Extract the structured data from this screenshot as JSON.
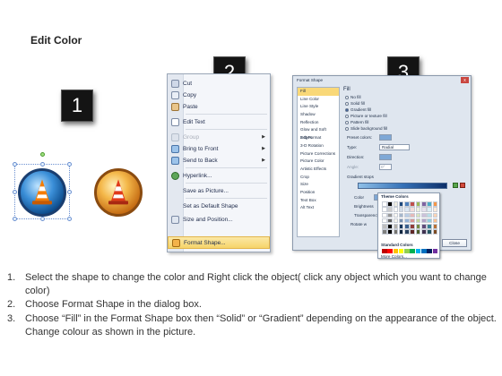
{
  "title": "Edit Color",
  "badges": [
    "1",
    "2",
    "3"
  ],
  "context_menu": {
    "items": [
      {
        "label": "Cut",
        "icon": "scissors-icon"
      },
      {
        "label": "Copy",
        "icon": "copy-icon"
      },
      {
        "label": "Paste",
        "icon": "paste-icon"
      },
      {
        "label": "Edit Text",
        "icon": "edit-text-icon"
      },
      {
        "label": "Group",
        "icon": "group-icon"
      },
      {
        "label": "Bring to Front",
        "icon": "bring-front-icon"
      },
      {
        "label": "Send to Back",
        "icon": "send-back-icon"
      },
      {
        "label": "Hyperlink...",
        "icon": "hyperlink-icon"
      },
      {
        "label": "Save as Picture...",
        "icon": ""
      },
      {
        "label": "Set as Default Shape",
        "icon": ""
      },
      {
        "label": "Size and Position...",
        "icon": "size-position-icon"
      },
      {
        "label": "Format Shape...",
        "icon": "format-shape-icon"
      }
    ]
  },
  "format_dialog": {
    "title": "Format Shape",
    "close": "x",
    "categories": [
      "Fill",
      "Line Color",
      "Line Style",
      "Shadow",
      "Reflection",
      "Glow and Soft Edges",
      "3-D Format",
      "3-D Rotation",
      "Picture Corrections",
      "Picture Color",
      "Artistic Effects",
      "Crop",
      "Size",
      "Position",
      "Text Box",
      "Alt Text"
    ],
    "selected_category": "Fill",
    "panel_heading": "Fill",
    "fill_options": [
      "No fill",
      "Solid fill",
      "Gradient fill",
      "Picture or texture fill",
      "Pattern fill",
      "Slide background fill"
    ],
    "selected_fill": "Gradient fill",
    "preset_colors_label": "Preset colors:",
    "type_label": "Type:",
    "type_value": "Radial",
    "direction_label": "Direction:",
    "angle_label": "Angle:",
    "angle_value": "0°",
    "gradient_stops_label": "Gradient stops",
    "color_label": "Color",
    "position_label": "Position:",
    "position_value": "0%",
    "brightness_label": "Brightness",
    "transparency_label": "Transparency",
    "rotate_label": "Rotate w",
    "theme_colors_label": "Theme Colors",
    "standard_colors_label": "Standard Colors",
    "more_colors_label": "More Colors...",
    "close_button": "Close",
    "theme_swatches": [
      "#ffffff",
      "#000000",
      "#eeece1",
      "#1f497d",
      "#4f81bd",
      "#c0504d",
      "#9bbb59",
      "#8064a2",
      "#4bacc6",
      "#f79646"
    ],
    "standard_swatches": [
      "#c00000",
      "#ff0000",
      "#ffc000",
      "#ffff00",
      "#92d050",
      "#00b050",
      "#00b0f0",
      "#0070c0",
      "#002060",
      "#7030a0"
    ]
  },
  "instructions": [
    {
      "num": "1.",
      "text": "Select the shape to change the color and Right click the object( click any object which you want to change color)"
    },
    {
      "num": "2.",
      "text": "Choose Format Shape in the dialog box."
    },
    {
      "num": "3.",
      "text": "Choose “Fill” in the Format Shape box then “Solid” or “Gradient” depending on the appearance of the object. Change colour as shown in the picture."
    }
  ]
}
